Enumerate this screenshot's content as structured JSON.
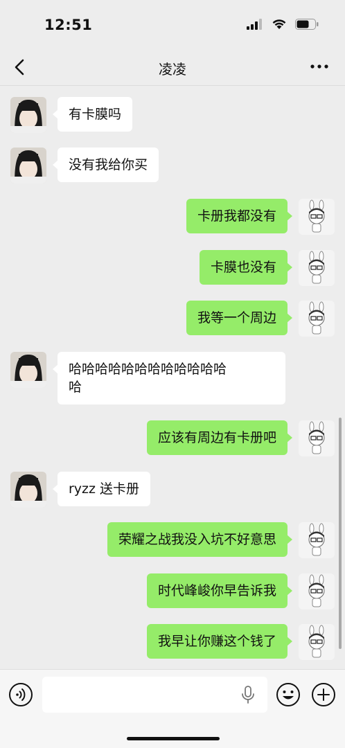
{
  "status_bar": {
    "time": "12:51"
  },
  "nav": {
    "title": "凌凌"
  },
  "messages": [
    {
      "side": "left",
      "text": "有卡膜吗"
    },
    {
      "side": "left",
      "text": "没有我给你买"
    },
    {
      "side": "right",
      "text": "卡册我都没有"
    },
    {
      "side": "right",
      "text": "卡膜也没有"
    },
    {
      "side": "right",
      "text": "我等一个周边"
    },
    {
      "side": "left",
      "text": "哈哈哈哈哈哈哈哈哈哈哈哈\n哈"
    },
    {
      "side": "right",
      "text": "应该有周边有卡册吧"
    },
    {
      "side": "left",
      "text": "ryzz 送卡册"
    },
    {
      "side": "right",
      "text": "荣耀之战我没入坑不好意思"
    },
    {
      "side": "right",
      "text": "时代峰峻你早告诉我"
    },
    {
      "side": "right",
      "text": "我早让你赚这个钱了"
    }
  ],
  "input": {
    "value": ""
  },
  "colors": {
    "sent_bubble": "#95ec69",
    "received_bubble": "#ffffff",
    "background": "#ededed"
  }
}
